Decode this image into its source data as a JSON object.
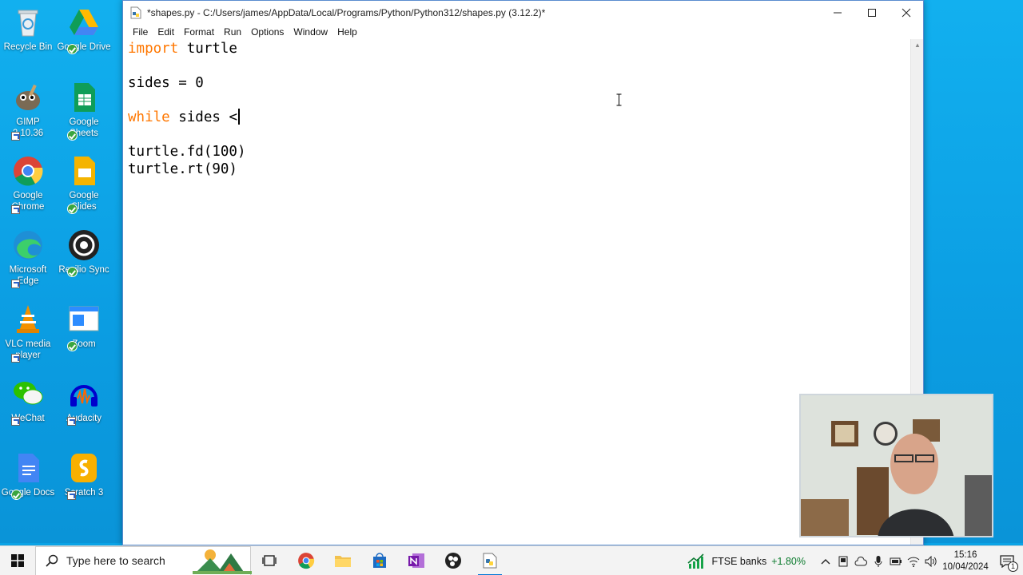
{
  "desktop": {
    "icons": [
      {
        "label": "Recycle Bin"
      },
      {
        "label": "Google Drive"
      },
      {
        "label": "GIMP 2.10.36"
      },
      {
        "label": "Google Sheets"
      },
      {
        "label": "Google Chrome"
      },
      {
        "label": "Google Slides"
      },
      {
        "label": "Microsoft Edge"
      },
      {
        "label": "Resilio Sync"
      },
      {
        "label": "VLC media player"
      },
      {
        "label": "Zoom"
      },
      {
        "label": "WeChat"
      },
      {
        "label": "Audacity"
      },
      {
        "label": "Google Docs"
      },
      {
        "label": "Scratch 3"
      }
    ]
  },
  "window": {
    "title": "*shapes.py - C:/Users/james/AppData/Local/Programs/Python/Python312/shapes.py (3.12.2)*",
    "menu": [
      "File",
      "Edit",
      "Format",
      "Run",
      "Options",
      "Window",
      "Help"
    ]
  },
  "editor": {
    "lines": [
      {
        "kw": "import",
        "rest": " turtle"
      },
      {
        "kw": "",
        "rest": "sides = 0"
      },
      {
        "kw": "while",
        "rest": " sides <"
      },
      {
        "kw": "",
        "rest": "turtle.fd(100)"
      },
      {
        "kw": "",
        "rest": "turtle.rt(90)"
      }
    ]
  },
  "taskbar": {
    "search_placeholder": "Type here to search",
    "ticker_label": "FTSE banks",
    "ticker_change": "+1.80%",
    "time": "15:16",
    "date": "10/04/2024",
    "notification_count": "1"
  },
  "colors": {
    "keyword": "#ff7700",
    "ticker_positive": "#0a7a2c",
    "accent": "#0078d7"
  }
}
